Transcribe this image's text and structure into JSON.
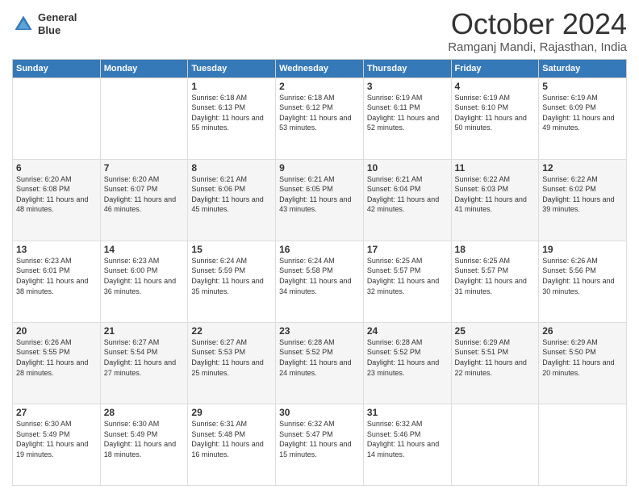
{
  "header": {
    "logo_line1": "General",
    "logo_line2": "Blue",
    "month": "October 2024",
    "location": "Ramganj Mandi, Rajasthan, India"
  },
  "days_of_week": [
    "Sunday",
    "Monday",
    "Tuesday",
    "Wednesday",
    "Thursday",
    "Friday",
    "Saturday"
  ],
  "weeks": [
    [
      {
        "day": "",
        "info": ""
      },
      {
        "day": "",
        "info": ""
      },
      {
        "day": "1",
        "info": "Sunrise: 6:18 AM\nSunset: 6:13 PM\nDaylight: 11 hours and 55 minutes."
      },
      {
        "day": "2",
        "info": "Sunrise: 6:18 AM\nSunset: 6:12 PM\nDaylight: 11 hours and 53 minutes."
      },
      {
        "day": "3",
        "info": "Sunrise: 6:19 AM\nSunset: 6:11 PM\nDaylight: 11 hours and 52 minutes."
      },
      {
        "day": "4",
        "info": "Sunrise: 6:19 AM\nSunset: 6:10 PM\nDaylight: 11 hours and 50 minutes."
      },
      {
        "day": "5",
        "info": "Sunrise: 6:19 AM\nSunset: 6:09 PM\nDaylight: 11 hours and 49 minutes."
      }
    ],
    [
      {
        "day": "6",
        "info": "Sunrise: 6:20 AM\nSunset: 6:08 PM\nDaylight: 11 hours and 48 minutes."
      },
      {
        "day": "7",
        "info": "Sunrise: 6:20 AM\nSunset: 6:07 PM\nDaylight: 11 hours and 46 minutes."
      },
      {
        "day": "8",
        "info": "Sunrise: 6:21 AM\nSunset: 6:06 PM\nDaylight: 11 hours and 45 minutes."
      },
      {
        "day": "9",
        "info": "Sunrise: 6:21 AM\nSunset: 6:05 PM\nDaylight: 11 hours and 43 minutes."
      },
      {
        "day": "10",
        "info": "Sunrise: 6:21 AM\nSunset: 6:04 PM\nDaylight: 11 hours and 42 minutes."
      },
      {
        "day": "11",
        "info": "Sunrise: 6:22 AM\nSunset: 6:03 PM\nDaylight: 11 hours and 41 minutes."
      },
      {
        "day": "12",
        "info": "Sunrise: 6:22 AM\nSunset: 6:02 PM\nDaylight: 11 hours and 39 minutes."
      }
    ],
    [
      {
        "day": "13",
        "info": "Sunrise: 6:23 AM\nSunset: 6:01 PM\nDaylight: 11 hours and 38 minutes."
      },
      {
        "day": "14",
        "info": "Sunrise: 6:23 AM\nSunset: 6:00 PM\nDaylight: 11 hours and 36 minutes."
      },
      {
        "day": "15",
        "info": "Sunrise: 6:24 AM\nSunset: 5:59 PM\nDaylight: 11 hours and 35 minutes."
      },
      {
        "day": "16",
        "info": "Sunrise: 6:24 AM\nSunset: 5:58 PM\nDaylight: 11 hours and 34 minutes."
      },
      {
        "day": "17",
        "info": "Sunrise: 6:25 AM\nSunset: 5:57 PM\nDaylight: 11 hours and 32 minutes."
      },
      {
        "day": "18",
        "info": "Sunrise: 6:25 AM\nSunset: 5:57 PM\nDaylight: 11 hours and 31 minutes."
      },
      {
        "day": "19",
        "info": "Sunrise: 6:26 AM\nSunset: 5:56 PM\nDaylight: 11 hours and 30 minutes."
      }
    ],
    [
      {
        "day": "20",
        "info": "Sunrise: 6:26 AM\nSunset: 5:55 PM\nDaylight: 11 hours and 28 minutes."
      },
      {
        "day": "21",
        "info": "Sunrise: 6:27 AM\nSunset: 5:54 PM\nDaylight: 11 hours and 27 minutes."
      },
      {
        "day": "22",
        "info": "Sunrise: 6:27 AM\nSunset: 5:53 PM\nDaylight: 11 hours and 25 minutes."
      },
      {
        "day": "23",
        "info": "Sunrise: 6:28 AM\nSunset: 5:52 PM\nDaylight: 11 hours and 24 minutes."
      },
      {
        "day": "24",
        "info": "Sunrise: 6:28 AM\nSunset: 5:52 PM\nDaylight: 11 hours and 23 minutes."
      },
      {
        "day": "25",
        "info": "Sunrise: 6:29 AM\nSunset: 5:51 PM\nDaylight: 11 hours and 22 minutes."
      },
      {
        "day": "26",
        "info": "Sunrise: 6:29 AM\nSunset: 5:50 PM\nDaylight: 11 hours and 20 minutes."
      }
    ],
    [
      {
        "day": "27",
        "info": "Sunrise: 6:30 AM\nSunset: 5:49 PM\nDaylight: 11 hours and 19 minutes."
      },
      {
        "day": "28",
        "info": "Sunrise: 6:30 AM\nSunset: 5:49 PM\nDaylight: 11 hours and 18 minutes."
      },
      {
        "day": "29",
        "info": "Sunrise: 6:31 AM\nSunset: 5:48 PM\nDaylight: 11 hours and 16 minutes."
      },
      {
        "day": "30",
        "info": "Sunrise: 6:32 AM\nSunset: 5:47 PM\nDaylight: 11 hours and 15 minutes."
      },
      {
        "day": "31",
        "info": "Sunrise: 6:32 AM\nSunset: 5:46 PM\nDaylight: 11 hours and 14 minutes."
      },
      {
        "day": "",
        "info": ""
      },
      {
        "day": "",
        "info": ""
      }
    ]
  ]
}
